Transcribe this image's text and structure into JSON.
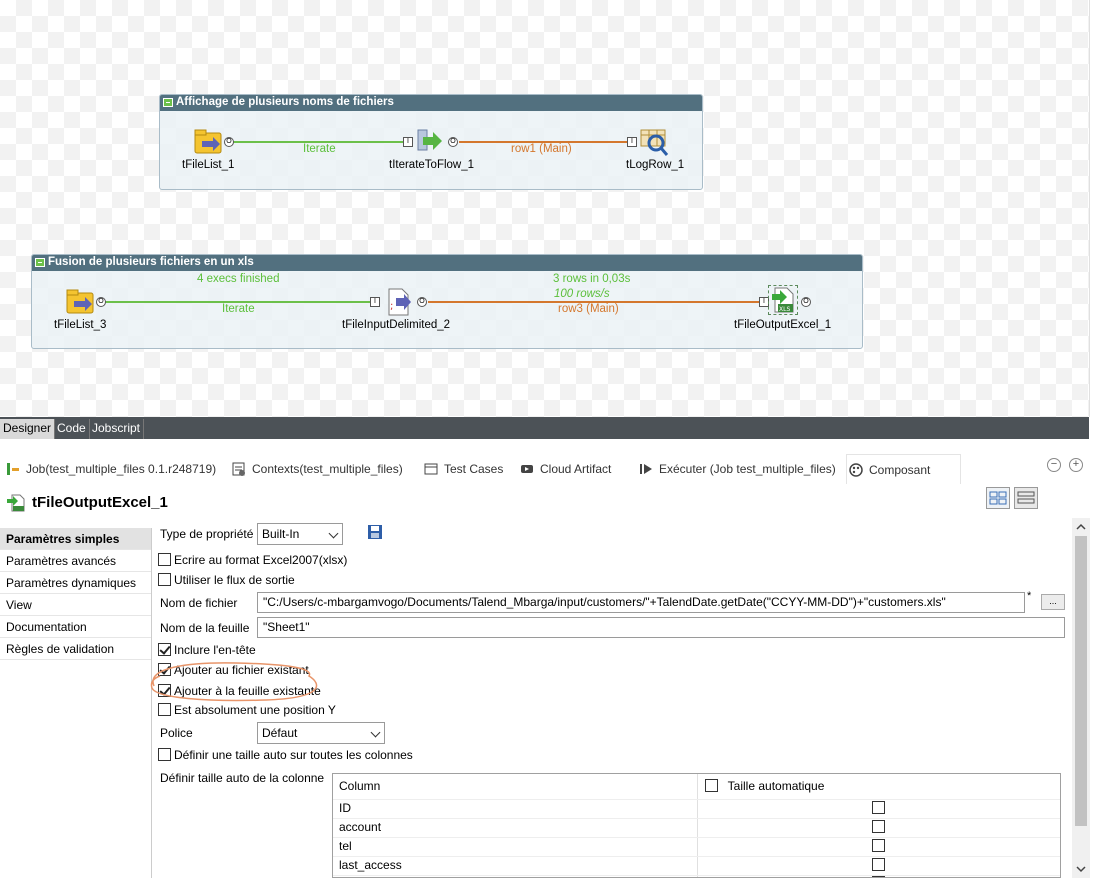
{
  "canvas": {
    "subjob1": {
      "title": "Affichage de plusieurs noms de fichiers",
      "components": [
        "tFileList_1",
        "tIterateToFlow_1",
        "tLogRow_1"
      ],
      "conn1": "Iterate",
      "conn2": "row1 (Main)"
    },
    "subjob2": {
      "title": "Fusion de plusieurs fichiers en un xls",
      "components": [
        "tFileList_3",
        "tFileInputDelimited_2",
        "tFileOutputExcel_1"
      ],
      "status1": "4 execs finished",
      "conn1": "Iterate",
      "stats_rows": "3 rows in 0,03s",
      "stats_rate": "100 rows/s",
      "conn2": "row3 (Main)"
    },
    "port_labels": {
      "out": "O",
      "in": "I"
    }
  },
  "designer_tabs": [
    "Designer",
    "Code",
    "Jobscript"
  ],
  "view_tabs": [
    "Job(test_multiple_files 0.1.r248719)",
    "Contexts(test_multiple_files)",
    "Test Cases",
    "Cloud Artifact",
    "Exécuter (Job test_multiple_files)",
    "Composant"
  ],
  "component_title": "tFileOutputExcel_1",
  "sidebar": [
    "Paramètres simples",
    "Paramètres avancés",
    "Paramètres dynamiques",
    "View",
    "Documentation",
    "Règles de validation"
  ],
  "form": {
    "type_propriete_label": "Type de propriété",
    "type_propriete_value": "Built-In",
    "ecrire_excel2007": {
      "label": "Ecrire au format Excel2007(xlsx)",
      "checked": false
    },
    "utiliser_flux": {
      "label": "Utiliser le flux de sortie",
      "checked": false
    },
    "nom_fichier_label": "Nom de fichier",
    "nom_fichier_value": "\"C:/Users/c-mbargamvogo/Documents/Talend_Mbarga/input/customers/\"+TalendDate.getDate(\"CCYY-MM-DD\")+\"customers.xls\"",
    "nom_fichier_asterisk": "*",
    "browse_label": "...",
    "nom_feuille_label": "Nom de la feuille",
    "nom_feuille_value": "\"Sheet1\"",
    "inclure_entete": {
      "label": "Inclure l'en-tête",
      "checked": true
    },
    "ajouter_fichier": {
      "label": "Ajouter au fichier existant",
      "checked": true
    },
    "ajouter_feuille": {
      "label": "Ajouter à la feuille existante",
      "checked": true
    },
    "position_y": {
      "label": "Est absolument une position Y",
      "checked": false
    },
    "police_label": "Police",
    "police_value": "Défaut",
    "taille_auto_toutes": {
      "label": "Définir une taille auto sur toutes les colonnes",
      "checked": false
    },
    "taille_auto_colonne_label": "Définir taille auto de la colonne"
  },
  "table": {
    "headers": [
      "Column",
      "Taille automatique"
    ],
    "rows": [
      "ID",
      "account",
      "tel",
      "last_access"
    ]
  }
}
